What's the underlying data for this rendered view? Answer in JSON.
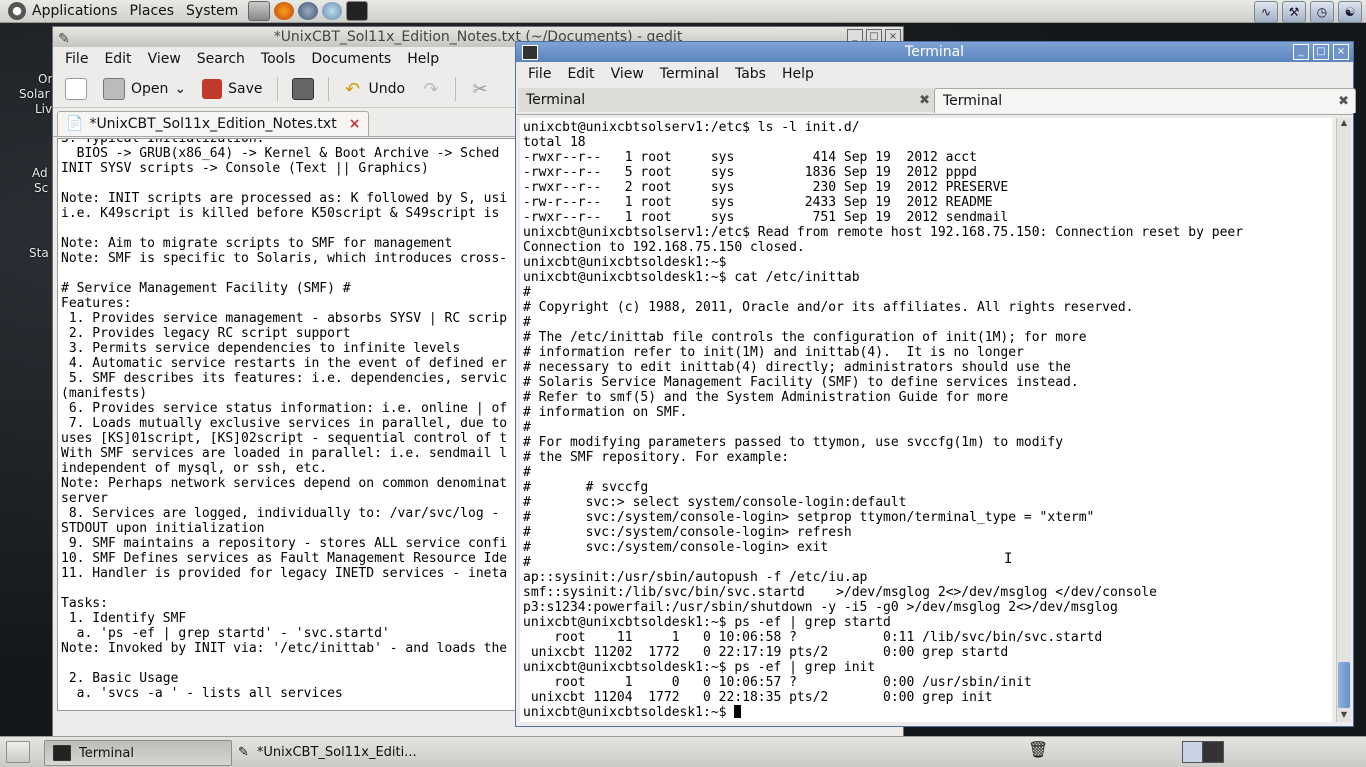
{
  "top_panel": {
    "menus": [
      "Applications",
      "Places",
      "System"
    ]
  },
  "desktop": {
    "labels": [
      "Or",
      "Solar",
      "Liv",
      "Ad",
      "Sc",
      "Sta"
    ]
  },
  "gedit": {
    "title": "*UnixCBT_Sol11x_Edition_Notes.txt (~/Documents) - gedit",
    "menus": [
      "File",
      "Edit",
      "View",
      "Search",
      "Tools",
      "Documents",
      "Help"
    ],
    "toolbar": {
      "open_label": "Open",
      "save_label": "Save",
      "undo_label": "Undo"
    },
    "tab_label": "*UnixCBT_Sol11x_Edition_Notes.txt",
    "content": "3. Typical Initialization:\n  BIOS -> GRUB(x86_64) -> Kernel & Boot Archive -> Sched\nINIT SYSV scripts -> Console (Text || Graphics)\n\nNote: INIT scripts are processed as: K followed by S, usi\ni.e. K49script is killed before K50script & S49script is\n\nNote: Aim to migrate scripts to SMF for management\nNote: SMF is specific to Solaris, which introduces cross-\n\n# Service Management Facility (SMF) #\nFeatures:\n 1. Provides service management - absorbs SYSV | RC scrip\n 2. Provides legacy RC script support\n 3. Permits service dependencies to infinite levels\n 4. Automatic service restarts in the event of defined er\n 5. SMF describes its features: i.e. dependencies, servic\n(manifests)\n 6. Provides service status information: i.e. online | of\n 7. Loads mutually exclusive services in parallel, due to\nuses [KS]01script, [KS]02script - sequential control of t\nWith SMF services are loaded in parallel: i.e. sendmail l\nindependent of mysql, or ssh, etc.\nNote: Perhaps network services depend on common denominat\nserver\n 8. Services are logged, individually to: /var/svc/log -\nSTDOUT upon initialization\n 9. SMF maintains a repository - stores ALL service confi\n10. SMF Defines services as Fault Management Resource Ide\n11. Handler is provided for legacy INETD services - ineta\n\nTasks:\n 1. Identify SMF\n  a. 'ps -ef | grep startd' - 'svc.startd'\nNote: Invoked by INIT via: '/etc/inittab' - and loads the\n\n 2. Basic Usage\n  a. 'svcs -a ' - lists all services"
  },
  "terminal": {
    "title": "Terminal",
    "menus": [
      "File",
      "Edit",
      "View",
      "Terminal",
      "Tabs",
      "Help"
    ],
    "tabs": [
      "Terminal",
      "Terminal"
    ],
    "lines": [
      "unixcbt@unixcbtsolserv1:/etc$ ls -l init.d/",
      "total 18",
      "-rwxr--r--   1 root     sys          414 Sep 19  2012 acct",
      "-rwxr--r--   5 root     sys         1836 Sep 19  2012 pppd",
      "-rwxr--r--   2 root     sys          230 Sep 19  2012 PRESERVE",
      "-rw-r--r--   1 root     sys         2433 Sep 19  2012 README",
      "-rwxr--r--   1 root     sys          751 Sep 19  2012 sendmail",
      "unixcbt@unixcbtsolserv1:/etc$ Read from remote host 192.168.75.150: Connection reset by peer",
      "Connection to 192.168.75.150 closed.",
      "unixcbt@unixcbtsoldesk1:~$",
      "unixcbt@unixcbtsoldesk1:~$ cat /etc/inittab",
      "#",
      "# Copyright (c) 1988, 2011, Oracle and/or its affiliates. All rights reserved.",
      "#",
      "# The /etc/inittab file controls the configuration of init(1M); for more",
      "# information refer to init(1M) and inittab(4).  It is no longer",
      "# necessary to edit inittab(4) directly; administrators should use the",
      "# Solaris Service Management Facility (SMF) to define services instead.",
      "# Refer to smf(5) and the System Administration Guide for more",
      "# information on SMF.",
      "#",
      "# For modifying parameters passed to ttymon, use svccfg(1m) to modify",
      "# the SMF repository. For example:",
      "#",
      "#       # svccfg",
      "#       svc:> select system/console-login:default",
      "#       svc:/system/console-login> setprop ttymon/terminal_type = \"xterm\"",
      "#       svc:/system/console-login> refresh",
      "#       svc:/system/console-login> exit",
      "#",
      "ap::sysinit:/usr/sbin/autopush -f /etc/iu.ap",
      "smf::sysinit:/lib/svc/bin/svc.startd    >/dev/msglog 2<>/dev/msglog </dev/console",
      "p3:s1234:powerfail:/usr/sbin/shutdown -y -i5 -g0 >/dev/msglog 2<>/dev/msglog",
      "unixcbt@unixcbtsoldesk1:~$ ps -ef | grep startd",
      "    root    11     1   0 10:06:58 ?           0:11 /lib/svc/bin/svc.startd",
      " unixcbt 11202  1772   0 22:17:19 pts/2       0:00 grep startd",
      "unixcbt@unixcbtsoldesk1:~$ ps -ef | grep init",
      "    root     1     0   0 10:06:57 ?           0:00 /usr/sbin/init",
      " unixcbt 11204  1772   0 22:18:35 pts/2       0:00 grep init"
    ],
    "prompt": "unixcbt@unixcbtsoldesk1:~$ "
  },
  "bottom_panel": {
    "tasks": [
      "Terminal",
      "*UnixCBT_Sol11x_Editi..."
    ]
  }
}
